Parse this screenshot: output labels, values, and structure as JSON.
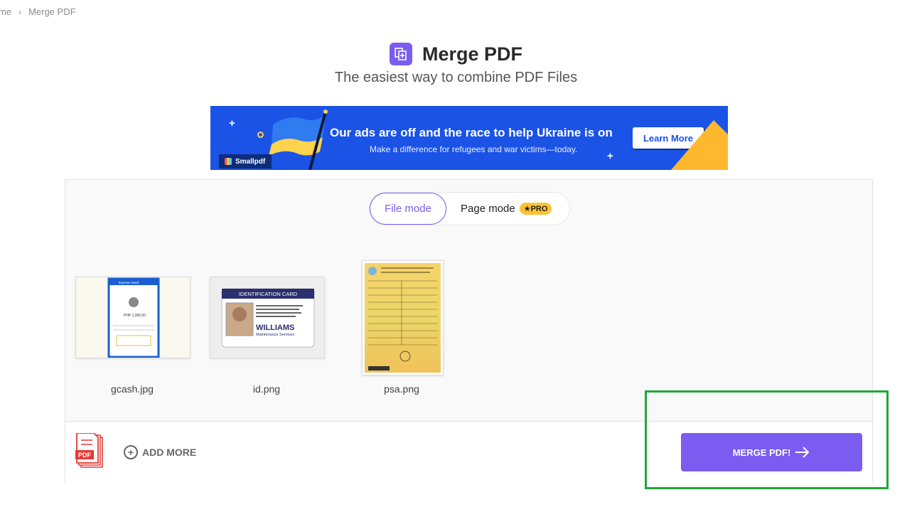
{
  "breadcrumb": {
    "home": "me",
    "separator": "›",
    "current": "Merge PDF"
  },
  "header": {
    "icon": "merge-pdf-icon",
    "title": "Merge PDF",
    "subtitle": "The easiest way to combine PDF Files",
    "accent_color": "#7b5cf0"
  },
  "banner": {
    "headline": "Our ads are off and the race to help Ukraine is on",
    "subline": "Make a difference for refugees and war victims—today.",
    "cta": "Learn More",
    "brand": "Smallpdf",
    "background_color": "#1a53e5"
  },
  "modes": {
    "file_mode": "File mode",
    "page_mode": "Page mode",
    "pro_badge": "★PRO"
  },
  "files": [
    {
      "name": "gcash.jpg"
    },
    {
      "name": "id.png"
    },
    {
      "name": "psa.png"
    }
  ],
  "id_card": {
    "title": "IDENTIFICATION CARD",
    "surname": "WILLIAMS",
    "company": "Maintenance Services"
  },
  "gcash_card": {
    "header": "Express Send",
    "amount": "PHP 1,000.00"
  },
  "footer": {
    "pdf_badge": "PDF",
    "add_more": "ADD MORE",
    "merge_button": "MERGE PDF!"
  }
}
